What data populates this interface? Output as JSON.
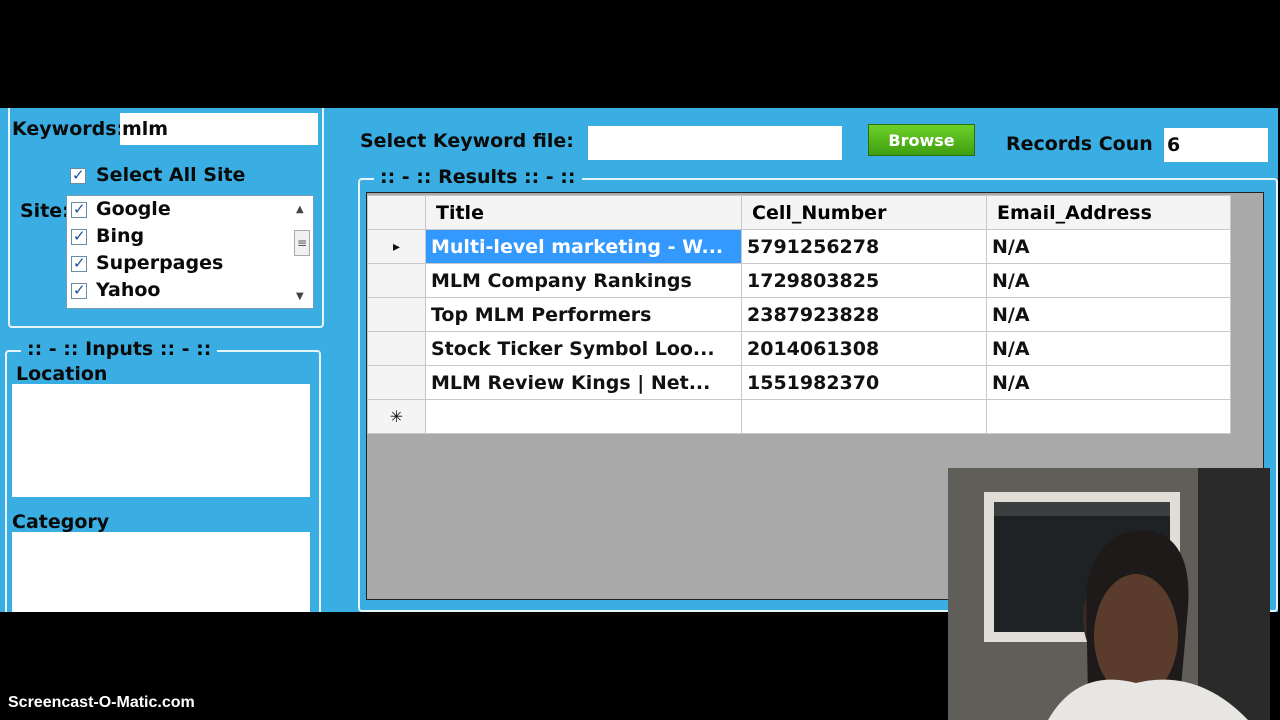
{
  "left": {
    "keywords_label": "Keywords:",
    "keywords_value": "mlm",
    "select_all_label": "Select All Site",
    "site_label": "Site:",
    "sites": [
      "Google",
      "Bing",
      "Superpages",
      "Yahoo"
    ],
    "inputs_legend": ":: - :: Inputs :: - ::",
    "location_label": "Location",
    "category_label": "Category"
  },
  "top": {
    "keyword_file_label": "Select Keyword file:",
    "browse_label": "Browse",
    "records_label": "Records Coun",
    "records_value": "6"
  },
  "results": {
    "legend": ":: - :: Results :: - ::",
    "columns": [
      "Title",
      "Cell_Number",
      "Email_Address"
    ],
    "rows": [
      {
        "title": "Multi-level marketing - W...",
        "cell": "5791256278",
        "email": "N/A"
      },
      {
        "title": "MLM Company Rankings",
        "cell": "1729803825",
        "email": "N/A"
      },
      {
        "title": "Top MLM Performers",
        "cell": "2387923828",
        "email": "N/A"
      },
      {
        "title": "Stock Ticker Symbol Loo...",
        "cell": "2014061308",
        "email": "N/A"
      },
      {
        "title": "MLM Review Kings | Net...",
        "cell": "1551982370",
        "email": "N/A"
      }
    ],
    "current_row_marker": "▸",
    "new_row_marker": "✳"
  },
  "footer": "Screencast-O-Matic.com",
  "colors": {
    "panel": "#3aaee2",
    "selected_row": "#3399ff",
    "browse": "#4fb41a"
  }
}
